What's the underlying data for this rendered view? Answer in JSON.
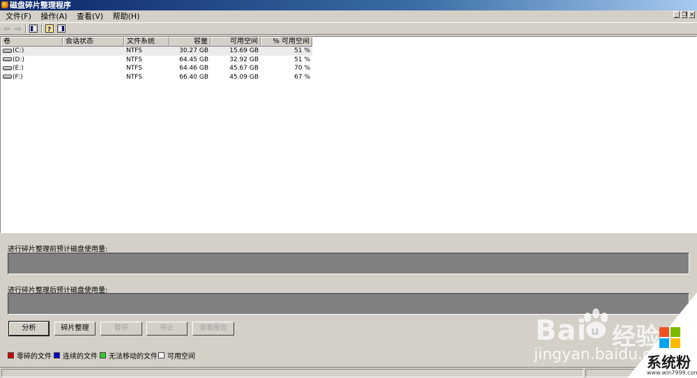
{
  "window": {
    "title": "磁盘碎片整理程序"
  },
  "menu": [
    {
      "label": "文件(F)"
    },
    {
      "label": "操作(A)"
    },
    {
      "label": "查看(V)"
    },
    {
      "label": "帮助(H)"
    }
  ],
  "window_controls": {
    "minimize": "_",
    "restore": "❐",
    "close": "×"
  },
  "list": {
    "columns": [
      "卷",
      "会话状态",
      "文件系统",
      "容量",
      "可用空间",
      "% 可用空间"
    ],
    "rows": [
      {
        "volume": "(C:)",
        "status": "",
        "fs": "NTFS",
        "capacity": "30.27 GB",
        "free": "15.69 GB",
        "pct": "51 %"
      },
      {
        "volume": "(D:)",
        "status": "",
        "fs": "NTFS",
        "capacity": "64.45 GB",
        "free": "32.92 GB",
        "pct": "51 %"
      },
      {
        "volume": "(E:)",
        "status": "",
        "fs": "NTFS",
        "capacity": "64.46 GB",
        "free": "45.67 GB",
        "pct": "70 %"
      },
      {
        "volume": "(F:)",
        "status": "",
        "fs": "NTFS",
        "capacity": "66.40 GB",
        "free": "45.09 GB",
        "pct": "67 %"
      }
    ]
  },
  "before_label": "进行碎片整理前预计磁盘使用量:",
  "after_label": "进行碎片整理后预计磁盘使用量:",
  "buttons": {
    "analyze": "分析",
    "defrag": "碎片整理",
    "pause": "暂停",
    "stop": "停止",
    "report": "查看报告"
  },
  "legend": [
    {
      "label": "零碎的文件",
      "color": "#cc0000"
    },
    {
      "label": "连续的文件",
      "color": "#0000cc"
    },
    {
      "label": "无法移动的文件",
      "color": "#33cc33"
    },
    {
      "label": "可用空间",
      "color": "#ffffff"
    }
  ],
  "watermark": {
    "baidu_brand": "Bai",
    "baidu_cn": "经验",
    "baidu_url": "jingyan.baidu.com",
    "site_name": "系统粉",
    "site_url": "www.win7999.com"
  }
}
